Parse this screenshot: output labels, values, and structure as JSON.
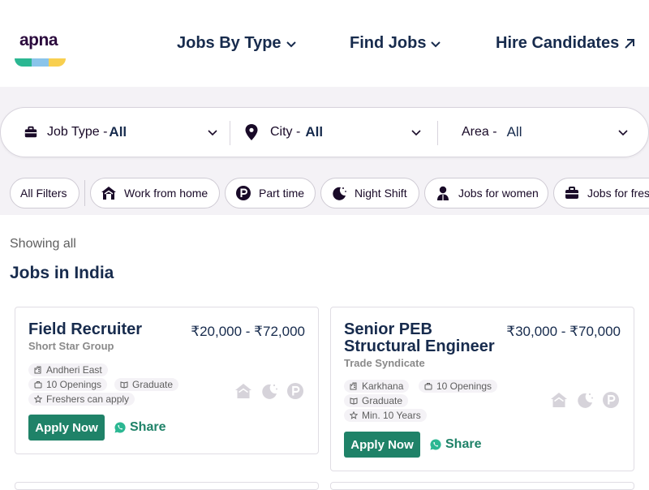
{
  "brand": {
    "name": "apna",
    "colors": {
      "green": "#2bb792",
      "blue": "#8ac4ea",
      "yellow": "#f8cf4f",
      "primary": "#1f8268",
      "navy": "#172b4d"
    }
  },
  "nav": {
    "jobs_by_type": "Jobs By Type",
    "find_jobs": "Find Jobs",
    "hire_candidates": "Hire Candidates"
  },
  "search": {
    "job_type": {
      "label": "Job Type -",
      "value": "All"
    },
    "city": {
      "label": "City -",
      "value": "All"
    },
    "area": {
      "label": "Area -",
      "value": "All"
    }
  },
  "filters": {
    "all_filters": "All Filters",
    "chips": [
      {
        "label": "Work from home",
        "icon": "home-icon"
      },
      {
        "label": "Part time",
        "icon": "part-time-icon"
      },
      {
        "label": "Night Shift",
        "icon": "moon-icon"
      },
      {
        "label": "Jobs for women",
        "icon": "woman-icon"
      },
      {
        "label": "Jobs for fresh",
        "icon": "briefcase-icon"
      }
    ]
  },
  "results": {
    "showing": "Showing all",
    "heading": "Jobs in India"
  },
  "jobs": [
    {
      "title": "Field Recruiter",
      "company": "Short Star Group",
      "salary": "₹20,000 - ₹72,000",
      "location": "Andheri East",
      "openings": "10 Openings",
      "education": "Graduate",
      "experience": "Freshers can apply",
      "apply": "Apply Now",
      "share": "Share"
    },
    {
      "title": "Senior PEB Structural Engineer",
      "company": "Trade Syndicate",
      "salary": "₹30,000 - ₹70,000",
      "location": "Karkhana",
      "openings": "10 Openings",
      "education": "Graduate",
      "experience": "Min. 10 Years",
      "apply": "Apply Now",
      "share": "Share"
    }
  ]
}
